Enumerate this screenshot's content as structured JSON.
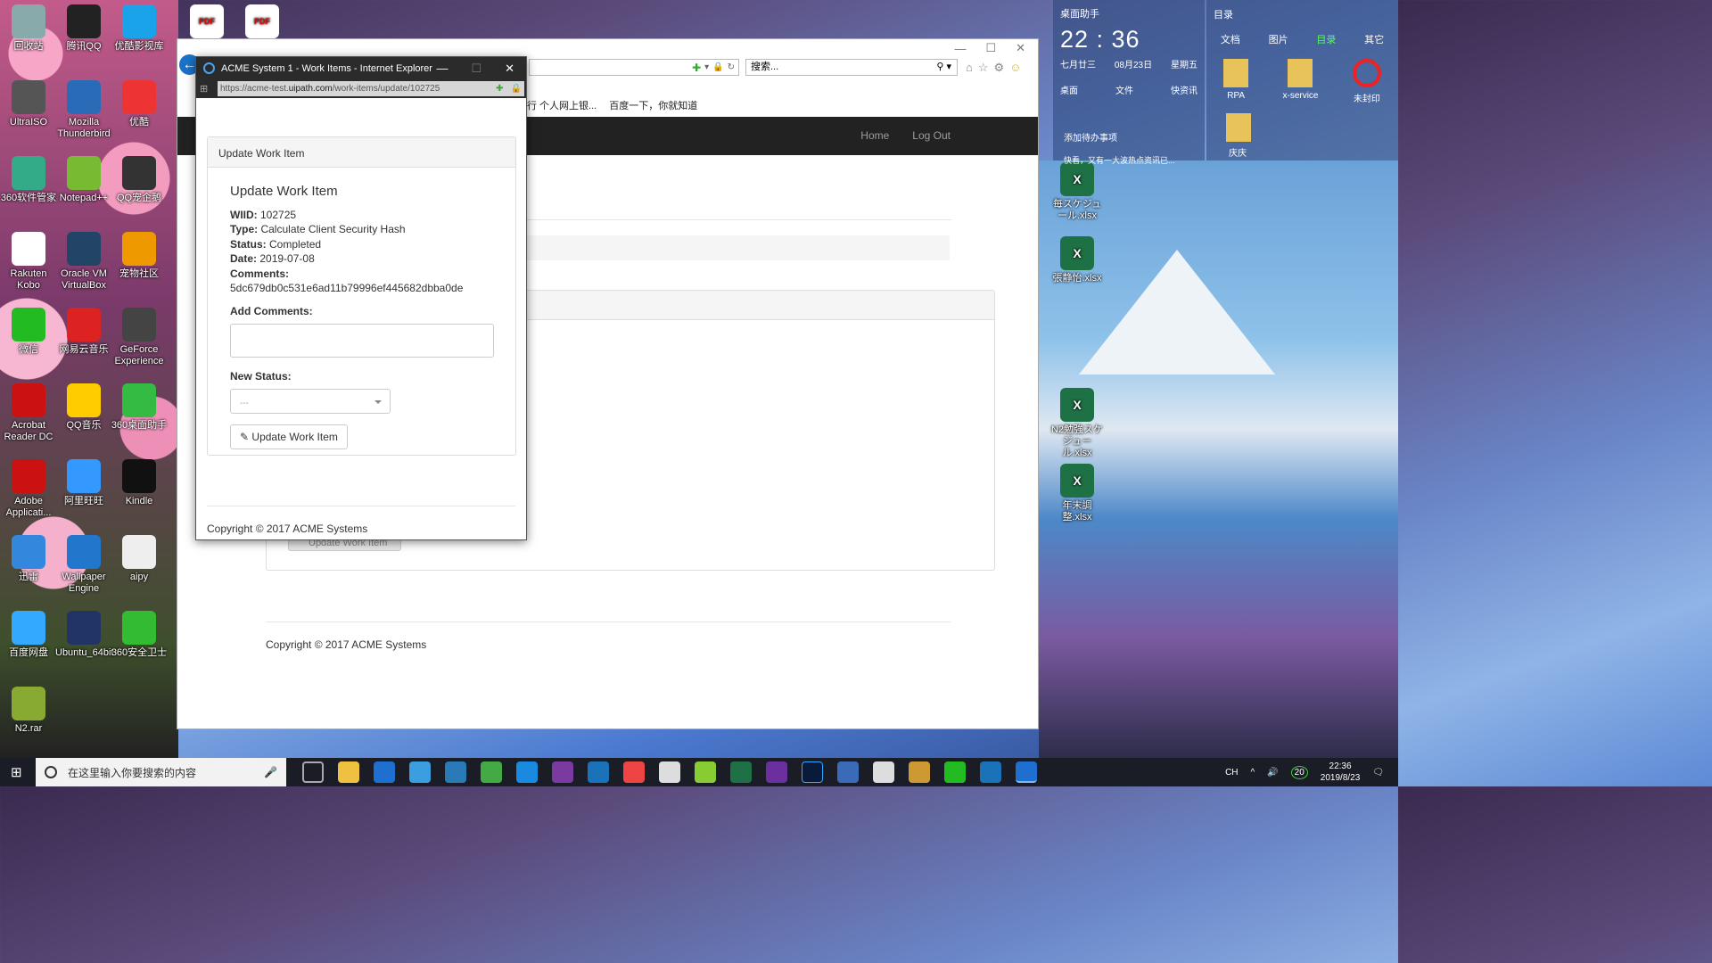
{
  "desktop": {
    "icons_left": [
      {
        "label": "回收站",
        "color": "#8aa"
      },
      {
        "label": "腾讯QQ",
        "color": "#222"
      },
      {
        "label": "优酷影视库",
        "color": "#1aa3e8"
      },
      {
        "label": "UltraISO",
        "color": "#555"
      },
      {
        "label": "Mozilla Thunderbird",
        "color": "#2a6bb8"
      },
      {
        "label": "优酷",
        "color": "#e33"
      },
      {
        "label": "360软件管家",
        "color": "#3a8"
      },
      {
        "label": "Notepad++",
        "color": "#7b3"
      },
      {
        "label": "QQ宠企鹅",
        "color": "#333"
      },
      {
        "label": "Rakuten Kobo",
        "color": "#fff"
      },
      {
        "label": "Oracle VM VirtualBox",
        "color": "#246"
      },
      {
        "label": "宠物社区",
        "color": "#e90"
      },
      {
        "label": "微信",
        "color": "#2b2"
      },
      {
        "label": "网易云音乐",
        "color": "#d22"
      },
      {
        "label": "GeForce Experience",
        "color": "#444"
      },
      {
        "label": "Acrobat Reader DC",
        "color": "#c11"
      },
      {
        "label": "QQ音乐",
        "color": "#fc0"
      },
      {
        "label": "360桌面助手",
        "color": "#3b4"
      },
      {
        "label": "Adobe Applicati...",
        "color": "#c11"
      },
      {
        "label": "阿里旺旺",
        "color": "#39f"
      },
      {
        "label": "Kindle",
        "color": "#111"
      },
      {
        "label": "迅雷",
        "color": "#38d"
      },
      {
        "label": "Wallpaper Engine",
        "color": "#27c"
      },
      {
        "label": "aipy",
        "color": "#eee"
      },
      {
        "label": "百度网盘",
        "color": "#3af"
      },
      {
        "label": "Ubuntu_64bit",
        "color": "#236"
      },
      {
        "label": "360安全卫士",
        "color": "#3b3"
      },
      {
        "label": "N2.rar",
        "color": "#8a3"
      }
    ],
    "icons_right": [
      {
        "label": "毎スケジュール.xlsx"
      },
      {
        "label": "張静怡.xlsx"
      },
      {
        "label": "N2勉強スケジュール.xlsx"
      },
      {
        "label": "年末調整.xlsx"
      }
    ],
    "pdf_label": "PDF"
  },
  "widget": {
    "title": "桌面助手",
    "time": "22 : 36",
    "lunar": "七月廿三",
    "date": "08月23日",
    "weekday": "星期五",
    "actions": [
      "桌面",
      "文件",
      "快资讯"
    ],
    "todo": "添加待办事项",
    "news": "快看，又有一大波热点资讯已..."
  },
  "files_panel": {
    "title": "目录",
    "tabs": [
      "文档",
      "图片",
      "目录",
      "其它"
    ],
    "items": [
      "RPA",
      "x-service",
      "未封印",
      "庆庆"
    ]
  },
  "ie_main": {
    "search_placeholder": "搜索...",
    "favorites": [
      "行 个人网上银...",
      "百度一下，你就知道"
    ],
    "nav_links": [
      "Home",
      "Log Out"
    ],
    "ghost_button": "Update Work Item",
    "copyright": "Copyright © 2017 ACME Systems"
  },
  "popup": {
    "title": "ACME System 1 - Work Items - Internet Explorer",
    "url_prefix": "https://acme-test.",
    "url_host": "uipath.com",
    "url_path": "/work-items/update/102725",
    "panel_heading": "Update Work Item",
    "heading": "Update Work Item",
    "wiid_label": "WIID:",
    "wiid": "102725",
    "type_label": "Type:",
    "type": "Calculate Client Security Hash",
    "status_label": "Status:",
    "status": "Completed",
    "date_label": "Date:",
    "date": "2019-07-08",
    "comments_label": "Comments:",
    "comments": "5dc679db0c531e6ad11b79996ef445682dbba0de",
    "add_comments_label": "Add Comments:",
    "new_status_label": "New Status:",
    "new_status_value": "---",
    "submit_label": "Update Work Item",
    "copyright": "Copyright © 2017 ACME Systems"
  },
  "taskbar": {
    "search_placeholder": "在这里输入你要搜索的内容",
    "ime": "CH",
    "badge": "20",
    "time": "22:36",
    "date": "2019/8/23"
  }
}
